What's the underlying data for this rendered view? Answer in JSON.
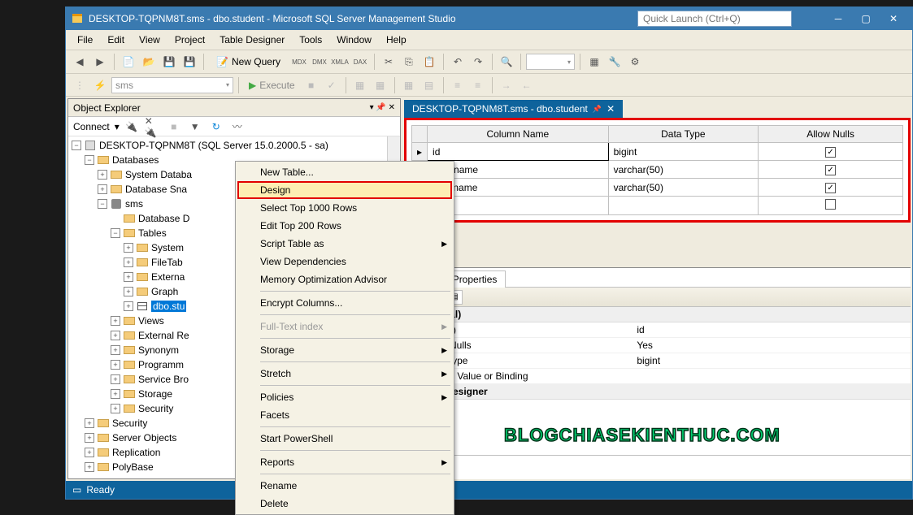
{
  "title": "DESKTOP-TQPNM8T.sms - dbo.student - Microsoft SQL Server Management Studio",
  "quick_launch_placeholder": "Quick Launch (Ctrl+Q)",
  "menubar": [
    "File",
    "Edit",
    "View",
    "Project",
    "Table Designer",
    "Tools",
    "Window",
    "Help"
  ],
  "toolbar": {
    "new_query": "New Query",
    "execute": "Execute",
    "db_combo": "sms"
  },
  "object_explorer": {
    "title": "Object Explorer",
    "connect": "Connect",
    "root": "DESKTOP-TQPNM8T (SQL Server 15.0.2000.5 - sa)",
    "nodes": {
      "databases": "Databases",
      "system_dbs": "System Databa",
      "db_snap": "Database Sna",
      "sms": "sms",
      "db_diag": "Database D",
      "tables": "Tables",
      "system": "System",
      "filetab": "FileTab",
      "externa": "Externa",
      "graph": "Graph",
      "dbostu": "dbo.stu",
      "views": "Views",
      "external_re": "External Re",
      "synonyms": "Synonym",
      "programm": "Programm",
      "service_bro": "Service Bro",
      "storage": "Storage",
      "security": "Security",
      "security2": "Security",
      "server_objects": "Server Objects",
      "replication": "Replication",
      "polybase": "PolyBase"
    }
  },
  "context_menu": [
    {
      "label": "New Table...",
      "type": "item"
    },
    {
      "label": "Design",
      "type": "item",
      "highlight": true
    },
    {
      "label": "Select Top 1000 Rows",
      "type": "item"
    },
    {
      "label": "Edit Top 200 Rows",
      "type": "item"
    },
    {
      "label": "Script Table as",
      "type": "sub"
    },
    {
      "label": "View Dependencies",
      "type": "item"
    },
    {
      "label": "Memory Optimization Advisor",
      "type": "item"
    },
    {
      "type": "sep"
    },
    {
      "label": "Encrypt Columns...",
      "type": "item"
    },
    {
      "type": "sep"
    },
    {
      "label": "Full-Text index",
      "type": "sub",
      "disabled": true
    },
    {
      "type": "sep"
    },
    {
      "label": "Storage",
      "type": "sub"
    },
    {
      "type": "sep"
    },
    {
      "label": "Stretch",
      "type": "sub"
    },
    {
      "type": "sep"
    },
    {
      "label": "Policies",
      "type": "sub"
    },
    {
      "label": "Facets",
      "type": "item"
    },
    {
      "type": "sep"
    },
    {
      "label": "Start PowerShell",
      "type": "item"
    },
    {
      "type": "sep"
    },
    {
      "label": "Reports",
      "type": "sub"
    },
    {
      "type": "sep"
    },
    {
      "label": "Rename",
      "type": "item"
    },
    {
      "label": "Delete",
      "type": "item"
    }
  ],
  "document_tab": "DESKTOP-TQPNM8T.sms - dbo.student",
  "designer": {
    "headers": [
      "Column Name",
      "Data Type",
      "Allow Nulls"
    ],
    "rows": [
      {
        "name": "id",
        "type": "bigint",
        "nulls": true,
        "current": true
      },
      {
        "name": "first_name",
        "type": "varchar(50)",
        "nulls": true
      },
      {
        "name": "last_name",
        "type": "varchar(50)",
        "nulls": true
      },
      {
        "name": "",
        "type": "",
        "nulls": false
      }
    ]
  },
  "column_properties": {
    "tab": "Column Properties",
    "group_general": "(General)",
    "rows": [
      {
        "n": "(Name)",
        "v": "id"
      },
      {
        "n": "Allow Nulls",
        "v": "Yes"
      },
      {
        "n": "Data Type",
        "v": "bigint"
      },
      {
        "n": "Default Value or Binding",
        "v": ""
      }
    ],
    "group_td": "Table Designer",
    "desc": "(General)"
  },
  "status": "Ready",
  "watermark": "BLOGCHIASEKIENTHUC.COM"
}
